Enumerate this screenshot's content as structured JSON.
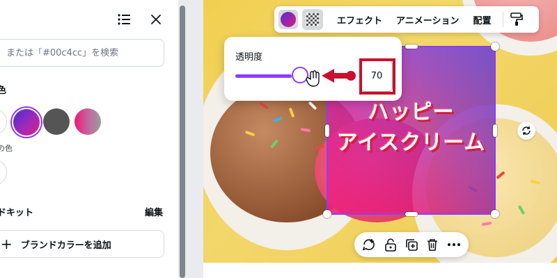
{
  "left_panel": {
    "search": {
      "placeholder": "または「#00c4cc」を検索"
    },
    "section_color": "色",
    "swatches": [
      {
        "name": "white",
        "color": "#ffffff"
      },
      {
        "name": "purple-pink-gradient",
        "color": "#7b2fd6"
      },
      {
        "name": "dark-gray",
        "color": "#555555"
      },
      {
        "name": "pink-gray-gradient",
        "color": "#e8206f"
      }
    ],
    "section_doc_color": "の色",
    "brand_kit_label": "ドキット",
    "edit_label": "編集",
    "add_brand_color_label": "ブランドカラーを追加"
  },
  "toolbar": {
    "effects": "エフェクト",
    "animation": "アニメーション",
    "position": "配置"
  },
  "transparency": {
    "label": "透明度",
    "value": "70",
    "slider_level": 0.7
  },
  "canvas": {
    "headline_line1": "ハッピー",
    "headline_line2": "アイスクリーム"
  },
  "colors": {
    "accent": "#8b3dff",
    "highlight": "#c8102e"
  }
}
